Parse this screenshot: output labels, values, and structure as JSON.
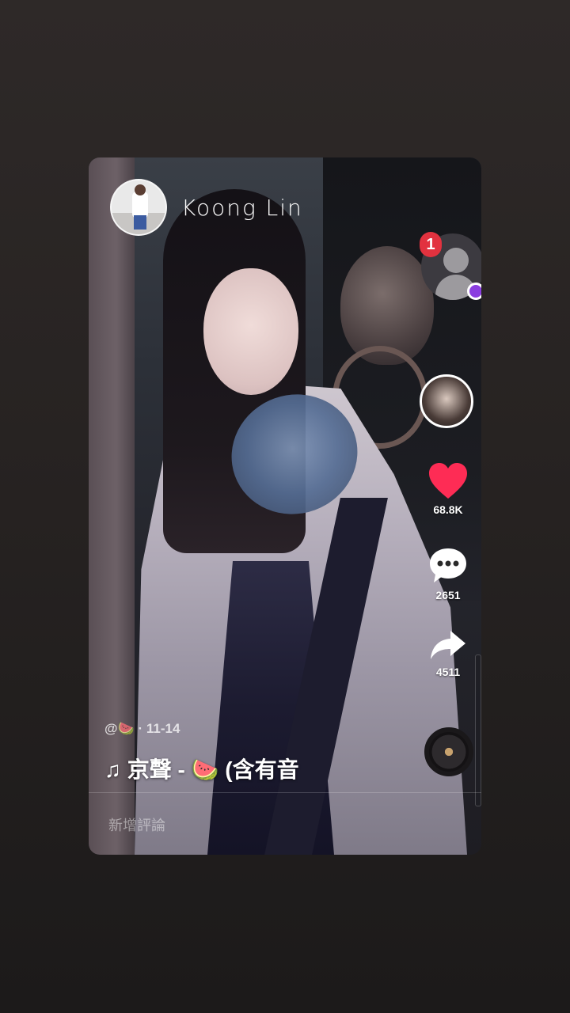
{
  "profile": {
    "username": "Koong Lin"
  },
  "notifications": {
    "badge_count": "1"
  },
  "actions": {
    "likes": "68.8K",
    "comments": "2651",
    "shares": "4511"
  },
  "video": {
    "author_handle": "@🍉",
    "date": "· 11-14",
    "music_label": "♫ 京聲 - 🍉 (含有音"
  },
  "comment": {
    "placeholder": "新增評論"
  },
  "icons": {
    "music": "music-note-icon",
    "like": "heart-icon",
    "comment": "speech-bubble-icon",
    "share": "share-arrow-icon"
  },
  "colors": {
    "like": "#fe2c55",
    "badge": "#e2323f",
    "live": "#8b3ee0"
  }
}
